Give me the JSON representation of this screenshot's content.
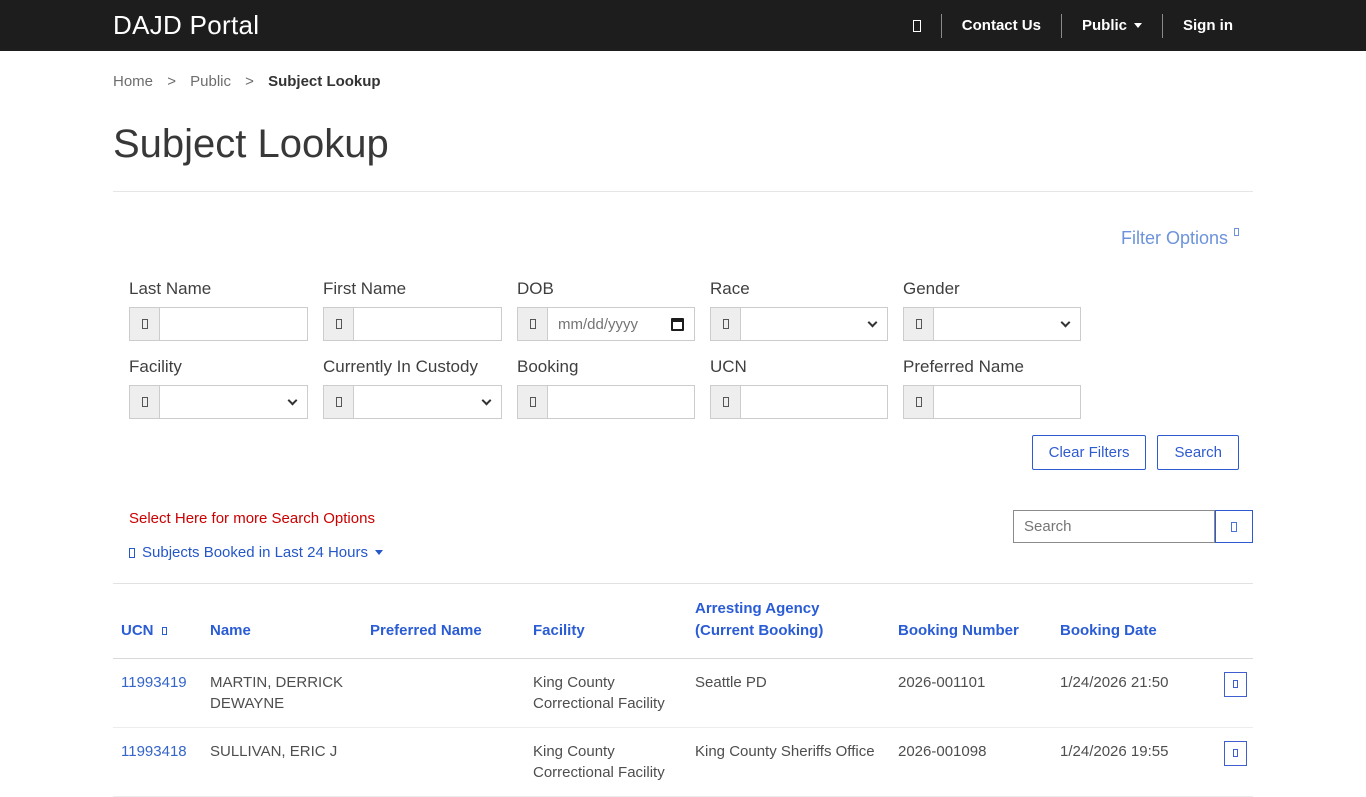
{
  "navbar": {
    "brand": "DAJD Portal",
    "icon": "tofu-box",
    "items": [
      {
        "label": "Contact Us"
      },
      {
        "label": "Public",
        "caret": "caret-down"
      },
      {
        "label": "Sign in"
      }
    ]
  },
  "breadcrumb": {
    "separator": ">",
    "items": [
      {
        "label": "Home"
      },
      {
        "label": "Public"
      },
      {
        "label": "Subject Lookup"
      }
    ]
  },
  "page": {
    "title": "Subject Lookup"
  },
  "filter": {
    "toggle_label": "Filter Options",
    "toggle_icon": "tofu-box",
    "addon_icon": "tofu-box",
    "fields": [
      {
        "label": "Last Name",
        "value": ""
      },
      {
        "label": "First Name",
        "value": ""
      },
      {
        "label": "DOB",
        "placeholder": "mm/dd/yyyy"
      },
      {
        "label": "Race",
        "value": ""
      },
      {
        "label": "Gender",
        "value": ""
      },
      {
        "label": "Facility",
        "value": ""
      },
      {
        "label": "Currently In Custody",
        "value": ""
      },
      {
        "label": "Booking",
        "value": ""
      },
      {
        "label": "UCN",
        "value": ""
      },
      {
        "label": "Preferred Name",
        "value": ""
      }
    ],
    "clear_filters_label": "Clear Filters",
    "search_label": "Search"
  },
  "actions": {
    "more_options_text": "Select Here for more Search Options",
    "booked_link_label": "Subjects Booked in Last 24 Hours",
    "booked_link_icon": "tofu-box",
    "booked_link_caret": "caret-down",
    "search_placeholder": "Search",
    "search_button_icon": "tofu-box"
  },
  "table": {
    "columns": [
      "UCN",
      "Name",
      "Preferred Name",
      "Facility",
      "Arresting Agency (Current Booking)",
      "Booking Number",
      "Booking Date"
    ],
    "sort_icon": "tofu-box",
    "row_action_icon": "tofu-box",
    "rows": [
      {
        "ucn": "11993419",
        "name": "MARTIN, DERRICK DEWAYNE",
        "preferred_name": "",
        "facility": "King County Correctional Facility",
        "arresting_agency": "Seattle PD",
        "booking_number": "2026-001101",
        "booking_date": "1/24/2026 21:50"
      },
      {
        "ucn": "11993418",
        "name": "SULLIVAN, ERIC J",
        "preferred_name": "",
        "facility": "King County Correctional Facility",
        "arresting_agency": "King County Sheriffs Office",
        "booking_number": "2026-001098",
        "booking_date": "1/24/2026 19:55"
      }
    ]
  },
  "colors": {
    "navbar_bg": "#1d1d1d",
    "header_blue": "#2a5cd5",
    "link_blue": "#3465c8",
    "light_blue": "#6d93da",
    "button_blue": "#2e5bd0",
    "alert_red": "#cc0000"
  }
}
